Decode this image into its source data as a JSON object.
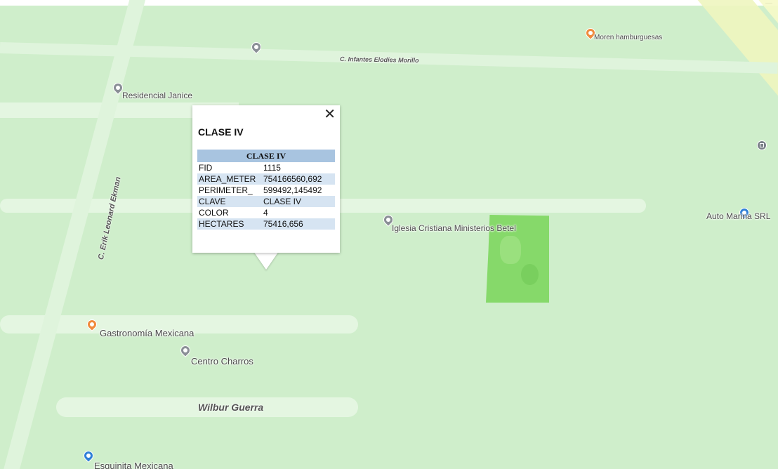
{
  "streets": {
    "infantes": "C. Infantes Elodíes Morillo",
    "erik": "C. Erik Leonard Ekman",
    "wilbur": "Wilbur Guerra"
  },
  "pois": {
    "moren": "Moren hamburguesas",
    "janice": "Residencial Janice",
    "iglesia": "Iglesia Cristiana Ministerios Betel",
    "auto": "Auto Marina SRL",
    "gastronomia": "Gastronomía Mexicana",
    "charros": "Centro Charros",
    "esquinita": "Esquinita Mexicana"
  },
  "popup": {
    "close": "✕",
    "title": "CLASE IV",
    "table_header": "CLASE IV",
    "rows": [
      {
        "key": "FID",
        "value": "1115"
      },
      {
        "key": "AREA_METER",
        "value": "754166560,692"
      },
      {
        "key": "PERIMETER_",
        "value": "599492,145492"
      },
      {
        "key": "CLAVE",
        "value": "CLASE IV"
      },
      {
        "key": "COLOR",
        "value": "4"
      },
      {
        "key": "HECTARES",
        "value": "75416,656"
      }
    ]
  },
  "colors": {
    "map_background": "#cfeecb",
    "parcel": "#86d96a",
    "table_header": "#a8c4e0",
    "table_alt_row": "#d6e4f2"
  }
}
